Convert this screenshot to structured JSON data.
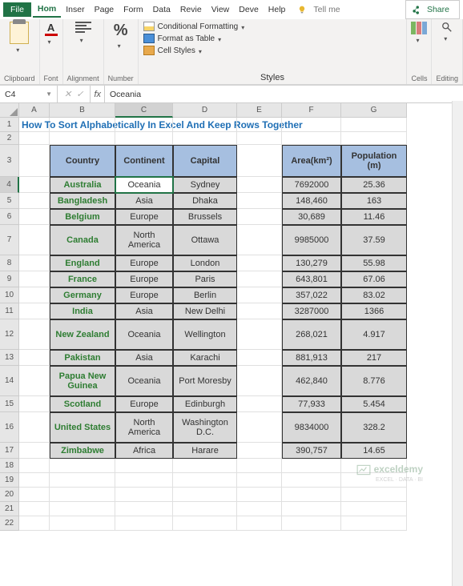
{
  "menu": {
    "file": "File",
    "tabs": [
      "Hom",
      "Inser",
      "Page",
      "Form",
      "Data",
      "Revie",
      "View",
      "Deve",
      "Help"
    ],
    "tellme": "Tell me",
    "share": "Share"
  },
  "ribbon": {
    "clipboard": "Clipboard",
    "font": "Font",
    "alignment": "Alignment",
    "number": "Number",
    "styles": "Styles",
    "cells": "Cells",
    "editing": "Editing",
    "conditional": "Conditional Formatting",
    "formatTable": "Format as Table",
    "cellStyles": "Cell Styles"
  },
  "namebox": "C4",
  "formula_value": "Oceania",
  "columns": [
    "A",
    "B",
    "C",
    "D",
    "E",
    "F",
    "G"
  ],
  "rows_visible": 22,
  "selected_cell": "C4",
  "title": "How To Sort Alphabetically In Excel And Keep Rows Together",
  "headers": {
    "B": "Country",
    "C": "Continent",
    "D": "Capital",
    "F": "Area(km²)",
    "G": "Population (m)"
  },
  "data": [
    {
      "row": 4,
      "B": "Australia",
      "C": "Oceania",
      "D": "Sydney",
      "F": "7692000",
      "G": "25.36"
    },
    {
      "row": 5,
      "B": "Bangladesh",
      "C": "Asia",
      "D": "Dhaka",
      "F": "148,460",
      "G": "163"
    },
    {
      "row": 6,
      "B": "Belgium",
      "C": "Europe",
      "D": "Brussels",
      "F": "30,689",
      "G": "11.46"
    },
    {
      "row": 7,
      "B": "Canada",
      "C": "North America",
      "D": "Ottawa",
      "F": "9985000",
      "G": "37.59"
    },
    {
      "row": 8,
      "B": "England",
      "C": "Europe",
      "D": "London",
      "F": "130,279",
      "G": "55.98"
    },
    {
      "row": 9,
      "B": "France",
      "C": "Europe",
      "D": "Paris",
      "F": "643,801",
      "G": "67.06"
    },
    {
      "row": 10,
      "B": "Germany",
      "C": "Europe",
      "D": "Berlin",
      "F": "357,022",
      "G": "83.02"
    },
    {
      "row": 11,
      "B": "India",
      "C": "Asia",
      "D": "New Delhi",
      "F": "3287000",
      "G": "1366"
    },
    {
      "row": 12,
      "B": "New Zealand",
      "C": "Oceania",
      "D": "Wellington",
      "F": "268,021",
      "G": "4.917"
    },
    {
      "row": 13,
      "B": "Pakistan",
      "C": "Asia",
      "D": "Karachi",
      "F": "881,913",
      "G": "217"
    },
    {
      "row": 14,
      "B": "Papua New Guinea",
      "C": "Oceania",
      "D": "Port Moresby",
      "F": "462,840",
      "G": "8.776"
    },
    {
      "row": 15,
      "B": "Scotland",
      "C": "Europe",
      "D": "Edinburgh",
      "F": "77,933",
      "G": "5.454"
    },
    {
      "row": 16,
      "B": "United States",
      "C": "North America",
      "D": "Washington D.C.",
      "F": "9834000",
      "G": "328.2"
    },
    {
      "row": 17,
      "B": "Zimbabwe",
      "C": "Africa",
      "D": "Harare",
      "F": "390,757",
      "G": "14.65"
    }
  ],
  "row_heights": {
    "1": 18,
    "2": 16,
    "3": 40,
    "4": 20,
    "5": 20,
    "6": 20,
    "7": 38,
    "8": 20,
    "9": 20,
    "10": 20,
    "11": 20,
    "12": 38,
    "13": 20,
    "14": 38,
    "15": 20,
    "16": 38,
    "17": 20,
    "18": 18,
    "19": 18,
    "20": 18,
    "21": 18,
    "22": 18
  },
  "watermark": {
    "brand": "exceldemy",
    "tag": "EXCEL · DATA · BI"
  }
}
